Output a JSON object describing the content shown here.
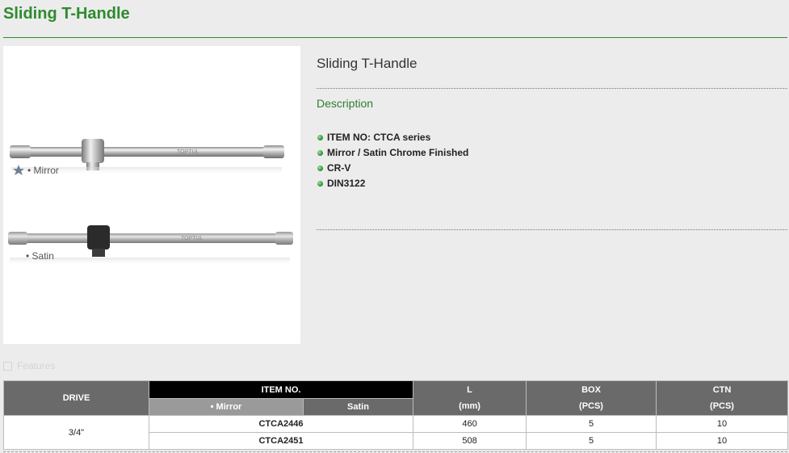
{
  "page": {
    "title": "Sliding T-Handle"
  },
  "product": {
    "name": "Sliding T-Handle",
    "description_heading": "Description",
    "image_labels": {
      "mirror": "• Mirror",
      "satin": "• Satin"
    },
    "image_brand_text": "TOPTUL",
    "features": [
      "ITEM NO: CTCA series",
      "Mirror / Satin Chrome Finished",
      "CR-V",
      "DIN3122"
    ]
  },
  "features_tab": {
    "label": "Features"
  },
  "spec_table": {
    "headers": {
      "drive": "DRIVE",
      "item_no": "ITEM NO.",
      "mirror": "• Mirror",
      "satin": "Satin",
      "l": "L",
      "l_unit": "(mm)",
      "box": "BOX",
      "box_unit": "(PCS)",
      "ctn": "CTN",
      "ctn_unit": "(PCS)"
    },
    "drive": "3/4\"",
    "rows": [
      {
        "item": "CTCA2446",
        "l": "460",
        "box": "5",
        "ctn": "10"
      },
      {
        "item": "CTCA2451",
        "l": "508",
        "box": "5",
        "ctn": "10"
      }
    ]
  },
  "colors": {
    "accent_green": "#2e8b2e",
    "header_grey": "#6a6a6a",
    "header_black": "#000000",
    "mirror_grey": "#9a9a9a"
  }
}
